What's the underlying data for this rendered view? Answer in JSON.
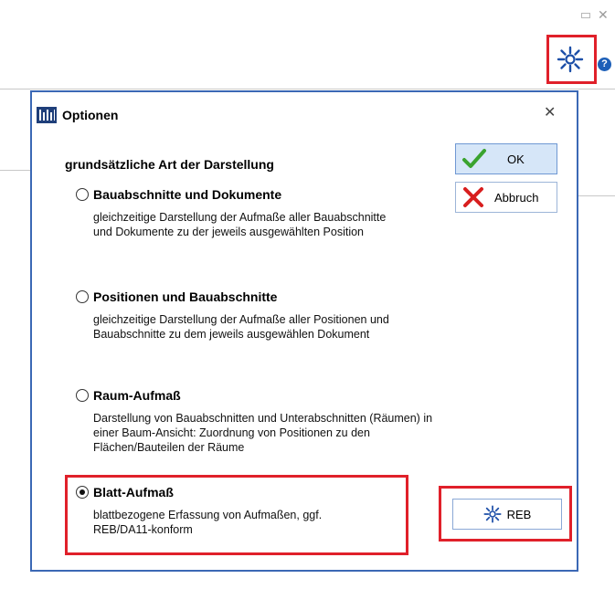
{
  "window": {
    "close_glyph": "✕"
  },
  "background": {
    "help_glyph": "?"
  },
  "dialog": {
    "title": "Optionen",
    "close_glyph": "✕",
    "heading": "grundsätzliche Art der Darstellung",
    "options": [
      {
        "label": "Bauabschnitte und Dokumente",
        "description": "gleichzeitige Darstellung der Aufmaße aller Bauabschnitte und Dokumente zu der jeweils ausgewählten Position",
        "selected": false
      },
      {
        "label": "Positionen und Bauabschnitte",
        "description": "gleichzeitige Darstellung der Aufmaße aller Positionen und Bauabschnitte zu dem jeweils ausgewählen Dokument",
        "selected": false
      },
      {
        "label": "Raum-Aufmaß",
        "description": "Darstellung von Bauabschnitten und Unterabschnitten (Räumen) in einer Baum-Ansicht: Zuordnung von Positionen zu den Flächen/Bauteilen der Räume",
        "selected": false
      },
      {
        "label": "Blatt-Aufmaß",
        "description": "blattbezogene Erfassung von Aufmaßen, ggf. REB/DA11-konform",
        "selected": true
      }
    ],
    "buttons": {
      "ok": "OK",
      "cancel": "Abbruch",
      "reb": "REB"
    }
  },
  "colors": {
    "dialog_border": "#3b68b5",
    "highlight_red": "#e0202a",
    "ok_check_green": "#3aa32f",
    "cancel_x_red": "#d81e1e",
    "gear_blue": "#1d4fa8"
  }
}
